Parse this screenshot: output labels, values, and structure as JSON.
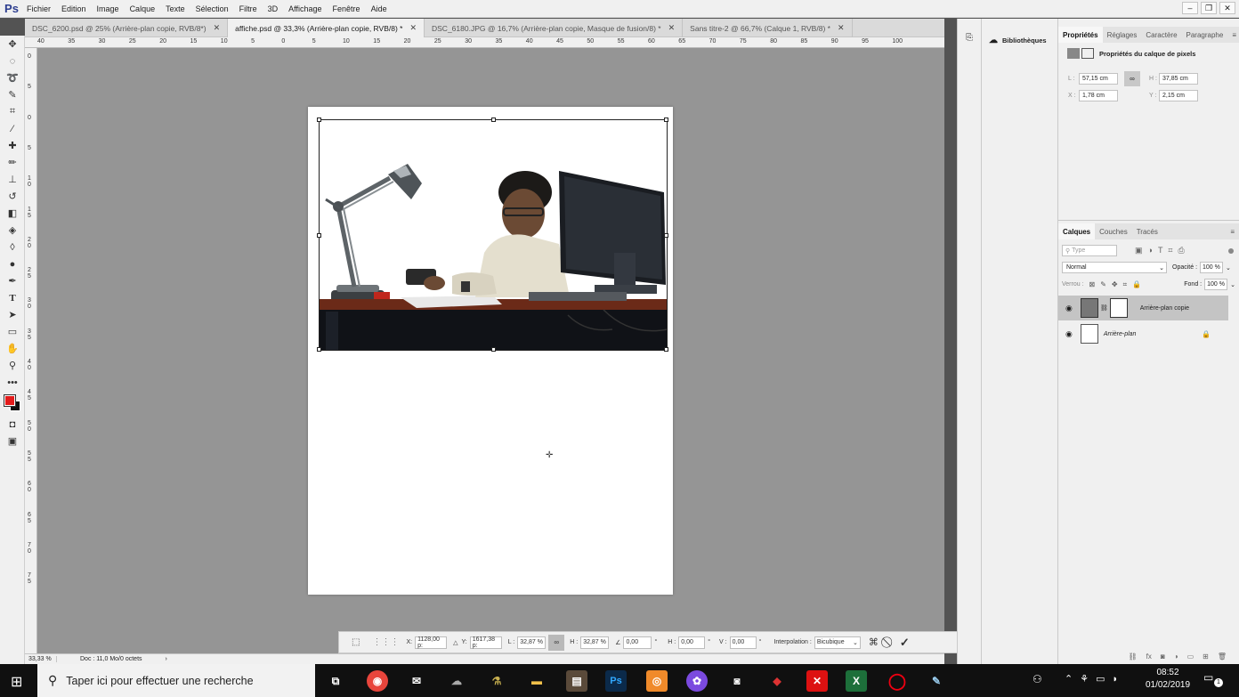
{
  "app": {
    "logo": "Ps"
  },
  "menu": [
    "Fichier",
    "Edition",
    "Image",
    "Calque",
    "Texte",
    "Sélection",
    "Filtre",
    "3D",
    "Affichage",
    "Fenêtre",
    "Aide"
  ],
  "tabs": [
    {
      "label": "DSC_6200.psd @ 25% (Arrière-plan copie, RVB/8*)",
      "active": false
    },
    {
      "label": "affiche.psd @ 33,3% (Arrière-plan copie, RVB/8) *",
      "active": true
    },
    {
      "label": "DSC_6180.JPG @ 16,7% (Arrière-plan copie, Masque de fusion/8) *",
      "active": false
    },
    {
      "label": "Sans titre-2 @ 66,7% (Calque 1, RVB/8) *",
      "active": false
    }
  ],
  "ruler_top": [
    "40",
    "35",
    "30",
    "25",
    "20",
    "15",
    "10",
    "5",
    "0",
    "5",
    "10",
    "15",
    "20",
    "25",
    "30",
    "35",
    "40",
    "45",
    "50",
    "55",
    "60",
    "65",
    "70",
    "75",
    "80",
    "85",
    "90",
    "95",
    "100"
  ],
  "ruler_left": [
    "0",
    "5",
    "0",
    "5",
    "1 0",
    "1 5",
    "2 0",
    "2 5",
    "3 0",
    "3 5",
    "4 0",
    "4 5",
    "5 0",
    "5 5",
    "6 0",
    "6 5",
    "7 0",
    "7 5"
  ],
  "status": {
    "zoom": "33,33 %",
    "doc": "Doc : 11,0 Mo/0 octets"
  },
  "options": {
    "x_label": "X:",
    "x_value": "1128,00 p:",
    "y_label": "Y:",
    "y_value": "1617,38 p:",
    "w_label": "L :",
    "w_value": "32,87 %",
    "h_label": "H :",
    "h_value": "32,87 %",
    "angle_value": "0,00",
    "skew_h_label": "H :",
    "skew_h_value": "0,00",
    "skew_v_label": "V :",
    "skew_v_value": "0,00",
    "deg": "°",
    "interp_label": "Interpolation :",
    "interp_value": "Bicubique"
  },
  "libraries": {
    "label": "Bibliothèques"
  },
  "properties": {
    "tabs": [
      "Propriétés",
      "Réglages",
      "Caractère",
      "Paragraphe"
    ],
    "title": "Propriétés du calque de pixels",
    "l_label": "L :",
    "l_value": "57,15 cm",
    "h_label": "H :",
    "h_value": "37,85 cm",
    "x_label": "X :",
    "x_value": "1,78 cm",
    "y_label": "Y :",
    "y_value": "2,15 cm"
  },
  "layers": {
    "tabs": [
      "Calques",
      "Couches",
      "Tracés"
    ],
    "filter_placeholder": "Type",
    "blend_mode": "Normal",
    "opacity_label": "Opacité :",
    "opacity_value": "100 %",
    "lock_label": "Verrou :",
    "fill_label": "Fond :",
    "fill_value": "100 %",
    "items": [
      {
        "name": "Arrière-plan copie",
        "selected": true
      },
      {
        "name": "Arrière-plan",
        "selected": false
      }
    ]
  },
  "taskbar": {
    "search_placeholder": "Taper ici pour effectuer une recherche",
    "time": "08:52",
    "date": "01/02/2019",
    "notif_count": "1"
  },
  "colors": {
    "foreground": "#e31b1b",
    "background": "#111111",
    "canvas": "#959595",
    "selected_layer": "#c4c4c4"
  }
}
